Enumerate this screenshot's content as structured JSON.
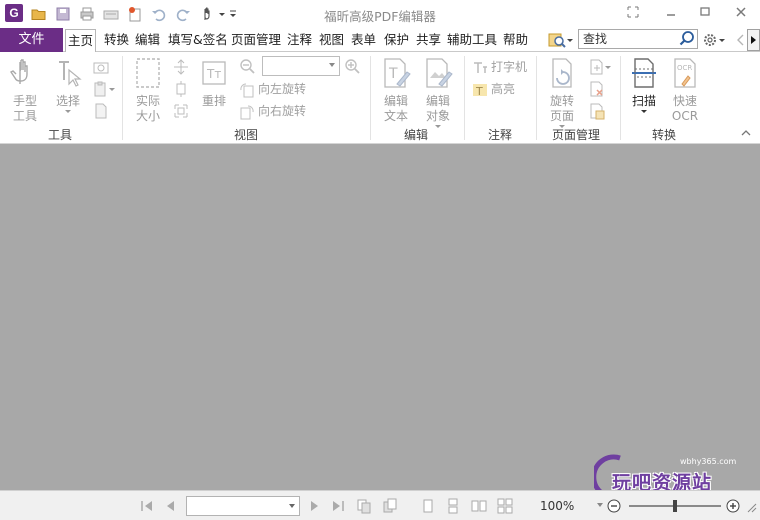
{
  "app": {
    "title": "福昕高级PDF编辑器",
    "logo_letter": "G"
  },
  "colors": {
    "accent": "#6b2d86",
    "document_bg": "#a8a8a8",
    "icon_disabled": "#a0a0a0"
  },
  "quick_access": [
    "open-folder-icon",
    "save-icon",
    "print-icon",
    "scan-icon",
    "new-icon",
    "undo-icon",
    "redo-icon",
    "hand-icon",
    "customize-icon"
  ],
  "window_controls": [
    "restore-layout-icon",
    "minimize-icon",
    "maximize-icon",
    "close-icon"
  ],
  "menu": {
    "file": "文件",
    "items": [
      "主页",
      "转换",
      "编辑",
      "填写&签名",
      "页面管理",
      "注释",
      "视图",
      "表单",
      "保护",
      "共享",
      "辅助工具",
      "帮助"
    ],
    "active_index": 0
  },
  "search": {
    "value": "查找"
  },
  "ribbon": {
    "groups": {
      "tools": "工具",
      "view": "视图",
      "edit": "编辑",
      "comment": "注释",
      "page_manage": "页面管理",
      "convert": "转换"
    },
    "buttons": {
      "hand_line1": "手型",
      "hand_line2": "工具",
      "select": "选择",
      "actual_line1": "实际",
      "actual_line2": "大小",
      "reflow": "重排",
      "rotate_left": "向左旋转",
      "rotate_right": "向右旋转",
      "edit_text_line1": "编辑",
      "edit_text_line2": "文本",
      "edit_object_line1": "编辑",
      "edit_object_line2": "对象",
      "typewriter": "打字机",
      "highlight": "高亮",
      "rotate_page_line1": "旋转",
      "rotate_page_line2": "页面",
      "scan": "扫描",
      "ocr_line1": "快速",
      "ocr_line2": "OCR"
    }
  },
  "watermark": {
    "url": "wbhy365.com",
    "text": "玩吧资源站"
  },
  "status": {
    "zoom": "100%",
    "zoom_slider_fraction": 0.5
  }
}
